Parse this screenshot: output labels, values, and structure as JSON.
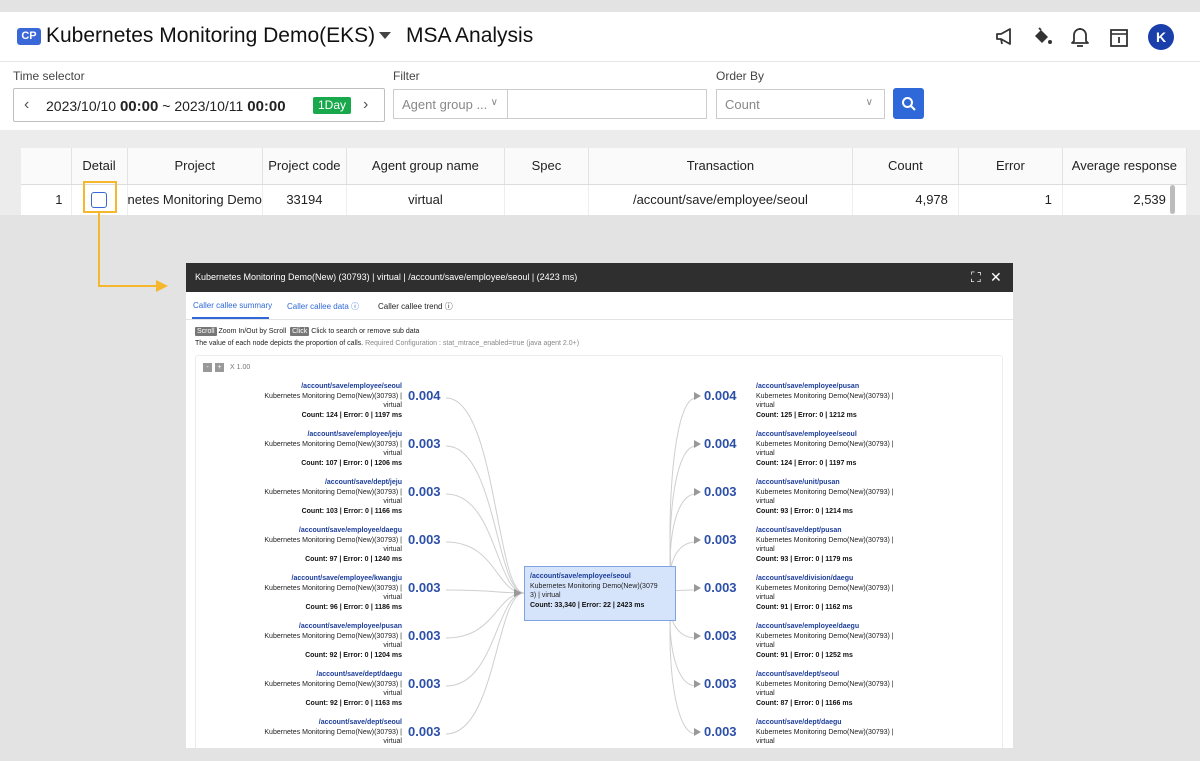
{
  "header": {
    "badge": "CP",
    "project_title": "Kubernetes Monitoring Demo(EKS)",
    "page_title": "MSA Analysis",
    "avatar_letter": "K",
    "icons": [
      "megaphone-icon",
      "paint-bucket-icon",
      "bell-icon",
      "calendar-icon"
    ]
  },
  "filters": {
    "time_label": "Time selector",
    "time_from_date": "2023/10/10",
    "time_from_time": "00:00",
    "time_sep": "~",
    "time_to_date": "2023/10/11",
    "time_to_time": "00:00",
    "range_badge": "1Day",
    "filter_label": "Filter",
    "filter_select": "Agent group ...",
    "filter_value": "",
    "order_label": "Order By",
    "order_select": "Count"
  },
  "grid": {
    "columns": [
      "",
      "Detail",
      "Project",
      "Project code",
      "Agent group name",
      "Spec",
      "Transaction",
      "Count",
      "Error",
      "Average response"
    ],
    "row": {
      "index": "1",
      "project": "netes Monitoring Demo",
      "project_code": "33194",
      "agent_group": "virtual",
      "spec": "",
      "transaction": "/account/save/employee/seoul",
      "count": "4,978",
      "error": "1",
      "avg_response": "2,539"
    }
  },
  "popup": {
    "title": "Kubernetes Monitoring Demo(New) (30793) | virtual | /account/save/employee/seoul | (2423 ms)",
    "tabs": [
      "Caller callee summary",
      "Caller callee data",
      "Caller callee trend"
    ],
    "hint_scroll_key": "Scroll",
    "hint_scroll_text": "Zoom In/Out by Scroll",
    "hint_click_key": "Click",
    "hint_click_text": "Click to search or remove sub data",
    "hint_line2": "The value of each node depicts the proportion of calls.",
    "hint_line2_muted": "Required Configuration : stat_mtrace_enabled=true (java agent 2.0+)",
    "zoom_minus": "-",
    "zoom_plus": "+",
    "zoom_level": "X 1.00",
    "center": {
      "url": "/account/save/employee/seoul",
      "project": "Kubernetes Monitoring Demo(New)(3079",
      "project2": "3) | virtual",
      "stats": "Count: 33,340 | Error: 22 | 2423 ms"
    },
    "callers": [
      {
        "url": "/account/save/employee/seoul",
        "project": "Kubernetes Monitoring Demo(New)(30793) |",
        "group": "virtual",
        "stats": "Count: 124 | Error: 0 | 1197 ms",
        "value": "0.004"
      },
      {
        "url": "/account/save/employee/jeju",
        "project": "Kubernetes Monitoring Demo(New)(30793) |",
        "group": "virtual",
        "stats": "Count: 107 | Error: 0 | 1206 ms",
        "value": "0.003"
      },
      {
        "url": "/account/save/dept/jeju",
        "project": "Kubernetes Monitoring Demo(New)(30793) |",
        "group": "virtual",
        "stats": "Count: 103 | Error: 0 | 1166 ms",
        "value": "0.003"
      },
      {
        "url": "/account/save/employee/daegu",
        "project": "Kubernetes Monitoring Demo(New)(30793) |",
        "group": "virtual",
        "stats": "Count: 97 | Error: 0 | 1240 ms",
        "value": "0.003"
      },
      {
        "url": "/account/save/employee/kwangju",
        "project": "Kubernetes Monitoring Demo(New)(30793) |",
        "group": "virtual",
        "stats": "Count: 96 | Error: 0 | 1186 ms",
        "value": "0.003"
      },
      {
        "url": "/account/save/employee/pusan",
        "project": "Kubernetes Monitoring Demo(New)(30793) |",
        "group": "virtual",
        "stats": "Count: 92 | Error: 0 | 1204 ms",
        "value": "0.003"
      },
      {
        "url": "/account/save/dept/daegu",
        "project": "Kubernetes Monitoring Demo(New)(30793) |",
        "group": "virtual",
        "stats": "Count: 92 | Error: 0 | 1163 ms",
        "value": "0.003"
      },
      {
        "url": "/account/save/dept/seoul",
        "project": "Kubernetes Monitoring Demo(New)(30793) |",
        "group": "virtual",
        "stats": "",
        "value": "0.003"
      }
    ],
    "callees": [
      {
        "url": "/account/save/employee/pusan",
        "project": "Kubernetes Monitoring Demo(New)(30793) |",
        "group": "virtual",
        "stats": "Count: 125 | Error: 0 | 1212 ms",
        "value": "0.004"
      },
      {
        "url": "/account/save/employee/seoul",
        "project": "Kubernetes Monitoring Demo(New)(30793) |",
        "group": "virtual",
        "stats": "Count: 124 | Error: 0 | 1197 ms",
        "value": "0.004"
      },
      {
        "url": "/account/save/unit/pusan",
        "project": "Kubernetes Monitoring Demo(New)(30793) |",
        "group": "virtual",
        "stats": "Count: 93 | Error: 0 | 1214 ms",
        "value": "0.003"
      },
      {
        "url": "/account/save/dept/pusan",
        "project": "Kubernetes Monitoring Demo(New)(30793) |",
        "group": "virtual",
        "stats": "Count: 93 | Error: 0 | 1179 ms",
        "value": "0.003"
      },
      {
        "url": "/account/save/division/daegu",
        "project": "Kubernetes Monitoring Demo(New)(30793) |",
        "group": "virtual",
        "stats": "Count: 91 | Error: 0 | 1162 ms",
        "value": "0.003"
      },
      {
        "url": "/account/save/employee/daegu",
        "project": "Kubernetes Monitoring Demo(New)(30793) |",
        "group": "virtual",
        "stats": "Count: 91 | Error: 0 | 1252 ms",
        "value": "0.003"
      },
      {
        "url": "/account/save/dept/seoul",
        "project": "Kubernetes Monitoring Demo(New)(30793) |",
        "group": "virtual",
        "stats": "Count: 87 | Error: 0 | 1166 ms",
        "value": "0.003"
      },
      {
        "url": "/account/save/dept/daegu",
        "project": "Kubernetes Monitoring Demo(New)(30793) |",
        "group": "virtual",
        "stats": "",
        "value": "0.003"
      }
    ]
  },
  "colors": {
    "accent": "#2f68d8",
    "badge_green": "#19a84b",
    "highlight": "#f4b72e",
    "popup_bar": "#2f2f2f",
    "node_fill": "#d6e4fb"
  }
}
